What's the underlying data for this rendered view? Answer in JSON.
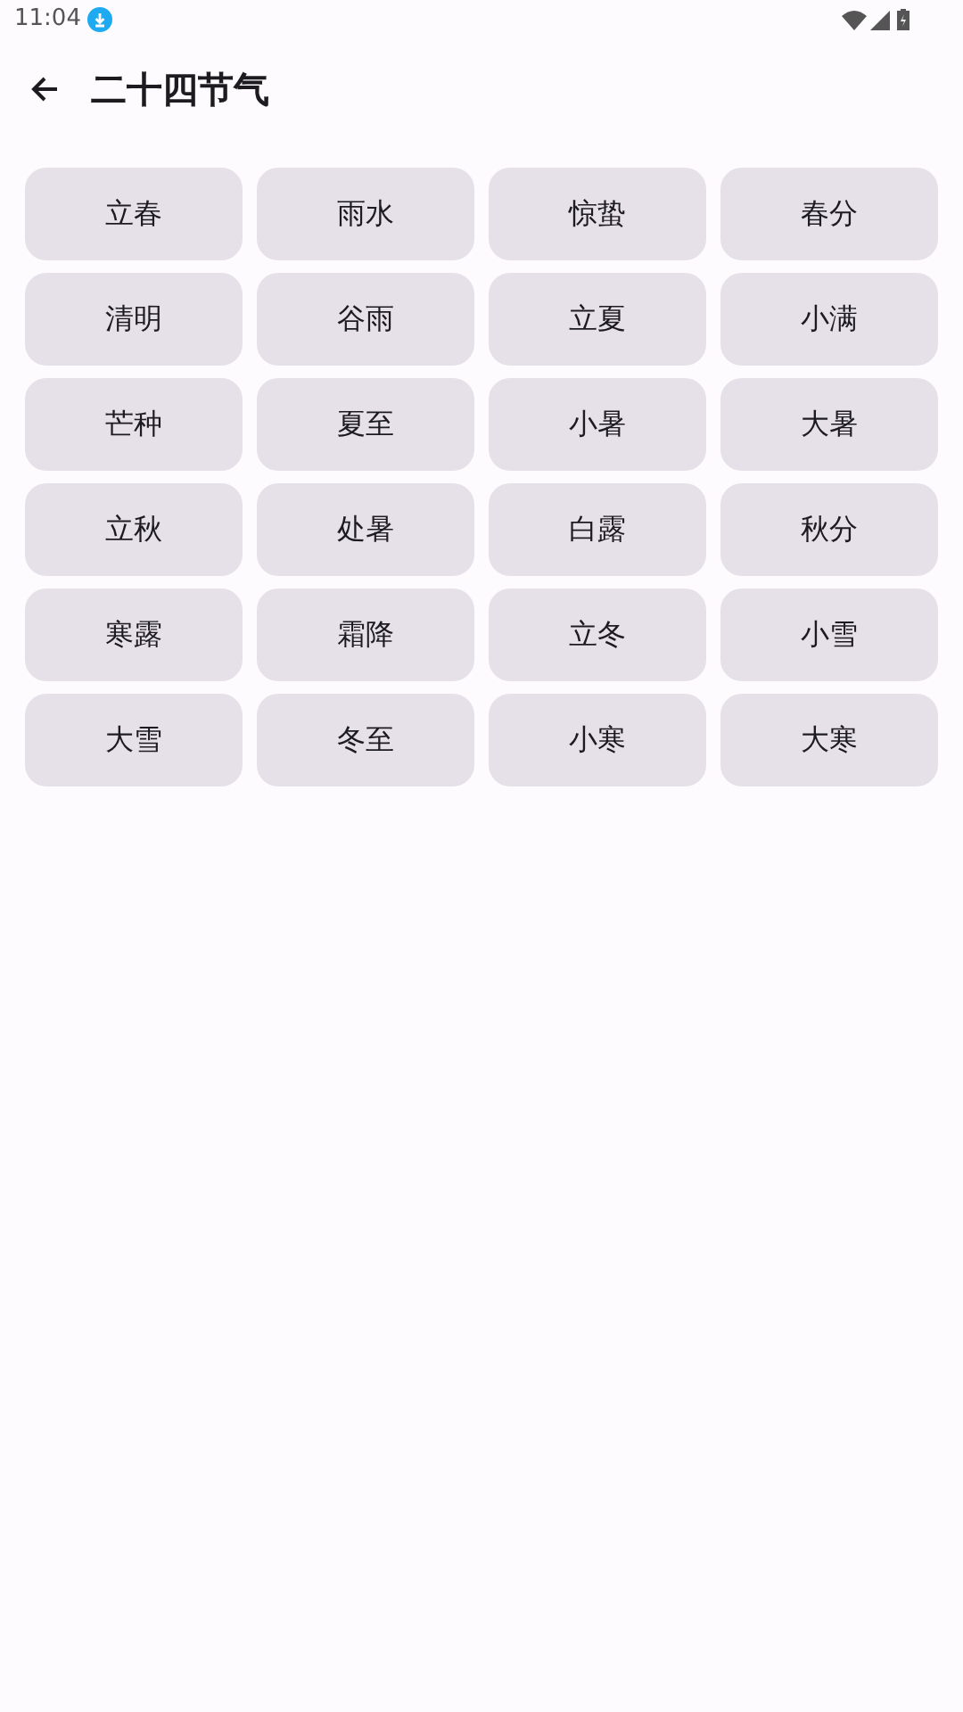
{
  "status_bar": {
    "time": "11:04"
  },
  "app_bar": {
    "title": "二十四节气"
  },
  "terms": [
    {
      "label": "立春"
    },
    {
      "label": "雨水"
    },
    {
      "label": "惊蛰"
    },
    {
      "label": "春分"
    },
    {
      "label": "清明"
    },
    {
      "label": "谷雨"
    },
    {
      "label": "立夏"
    },
    {
      "label": "小满"
    },
    {
      "label": "芒种"
    },
    {
      "label": "夏至"
    },
    {
      "label": "小暑"
    },
    {
      "label": "大暑"
    },
    {
      "label": "立秋"
    },
    {
      "label": "处暑"
    },
    {
      "label": "白露"
    },
    {
      "label": "秋分"
    },
    {
      "label": "寒露"
    },
    {
      "label": "霜降"
    },
    {
      "label": "立冬"
    },
    {
      "label": "小雪"
    },
    {
      "label": "大雪"
    },
    {
      "label": "冬至"
    },
    {
      "label": "小寒"
    },
    {
      "label": "大寒"
    }
  ]
}
